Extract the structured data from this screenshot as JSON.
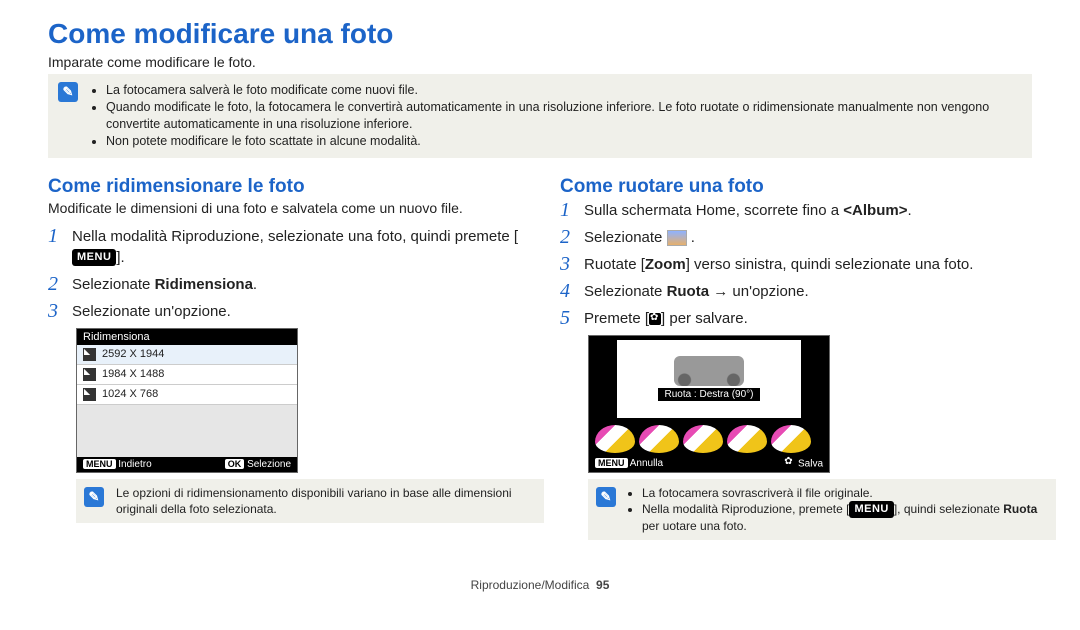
{
  "title": "Come modificare una foto",
  "intro": "Imparate come modificare le foto.",
  "top_notes": [
    "La fotocamera salverà le foto modificate come nuovi file.",
    "Quando modificate le foto, la fotocamera le convertirà automaticamente in una risoluzione inferiore. Le foto ruotate o ridimensionate manualmente non vengono convertite automaticamente in una risoluzione inferiore.",
    "Non potete modificare le foto scattate in alcune modalità."
  ],
  "left": {
    "heading": "Come ridimensionare le foto",
    "lead": "Modificate le dimensioni di una foto e salvatela come un nuovo file.",
    "steps": [
      {
        "n": "1",
        "before": "Nella modalità Riproduzione, selezionate una foto, quindi premete [",
        "pill": "MENU",
        "after": "]."
      },
      {
        "n": "2",
        "before": "Selezionate ",
        "bold": "Ridimensiona",
        "after": "."
      },
      {
        "n": "3",
        "before": "Selezionate un'opzione."
      }
    ],
    "screen": {
      "title": "Ridimensiona",
      "rows": [
        "2592 X 1944",
        "1984 X 1488",
        "1024 X 768"
      ],
      "footer_left_tag": "MENU",
      "footer_left": "Indietro",
      "footer_right_tag": "OK",
      "footer_right": "Selezione"
    },
    "note": "Le opzioni di ridimensionamento disponibili variano in base alle dimensioni originali della foto selezionata."
  },
  "right": {
    "heading": "Come ruotare una foto",
    "steps": [
      {
        "n": "1",
        "before": "Sulla schermata Home, scorrete fino a ",
        "bold": "<Album>",
        "after": "."
      },
      {
        "n": "2",
        "before": "Selezionate ",
        "icon": true,
        "after": " ."
      },
      {
        "n": "3",
        "before": "Ruotate [",
        "bold": "Zoom",
        "after": "] verso sinistra, quindi selezionate una foto."
      },
      {
        "n": "4",
        "before": "Selezionate ",
        "bold": "Ruota",
        "after": " → un'opzione."
      },
      {
        "n": "5",
        "before": "Premete [",
        "flower": true,
        "after": "] per salvare."
      }
    ],
    "screen": {
      "label": "Ruota : Destra (90°)",
      "footer_left_tag": "MENU",
      "footer_left": "Annulla",
      "footer_right": "Salva"
    },
    "notes": [
      "La fotocamera sovrascriverà il file originale.",
      "Nella modalità Riproduzione, premete [MENU], quindi selezionate Ruota per uotare una foto."
    ]
  },
  "footer": {
    "section": "Riproduzione/Modifica",
    "page": "95"
  }
}
